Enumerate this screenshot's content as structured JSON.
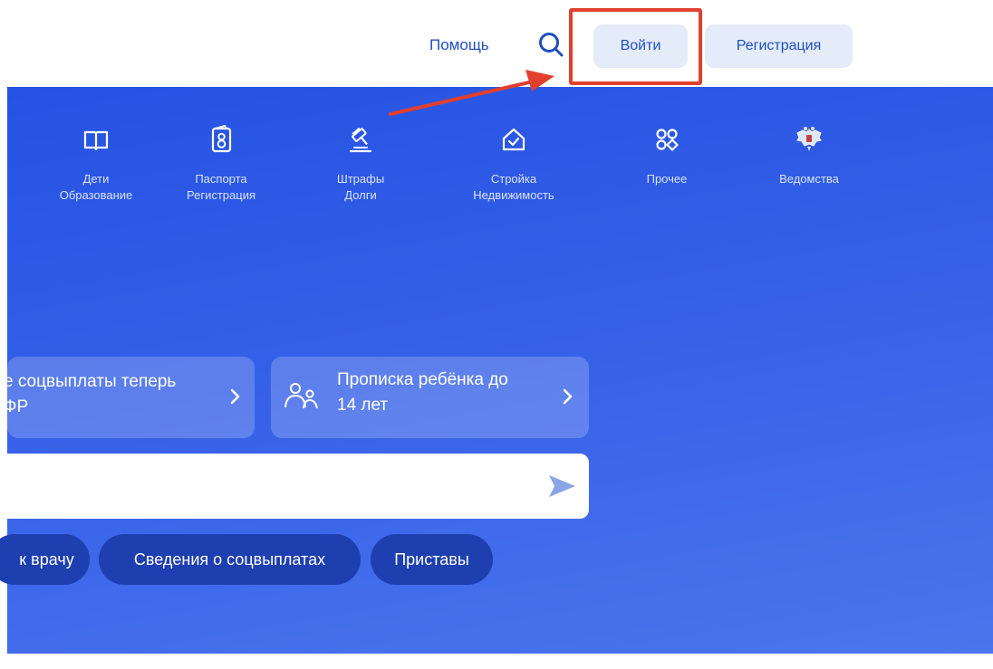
{
  "header": {
    "help_label": "Помощь",
    "search_icon": "search-icon",
    "login_label": "Войти",
    "register_label": "Регистрация"
  },
  "categories": [
    {
      "line1": "Дети",
      "line2": "Образование",
      "icon": "book-icon"
    },
    {
      "line1": "Паспорта",
      "line2": "Регистрация",
      "icon": "passport-icon"
    },
    {
      "line1": "Штрафы",
      "line2": "Долги",
      "icon": "gavel-icon"
    },
    {
      "line1": "Стройка",
      "line2": "Недвижимость",
      "icon": "house-icon"
    },
    {
      "line1": "Прочее",
      "line2": "",
      "icon": "grid-icon"
    },
    {
      "line1": "Ведомства",
      "line2": "",
      "icon": "coat-of-arms-icon"
    }
  ],
  "promos": [
    {
      "line1": "е соцвыплаты теперь",
      "line2": "ФР"
    },
    {
      "line1": "Прописка ребёнка до",
      "line2": "14 лет",
      "icon": "people-icon"
    }
  ],
  "search": {
    "placeholder": "",
    "send_icon": "send-icon"
  },
  "chips": [
    "к врачу",
    "Сведения о соцвыплатах",
    "Приставы"
  ],
  "colors": {
    "hero_blue": "#2652e3",
    "link_blue": "#1f4fc0",
    "button_bg": "#e4ebf9",
    "highlight_red": "#e1402e",
    "chip_bg": "#1d3fb0"
  }
}
